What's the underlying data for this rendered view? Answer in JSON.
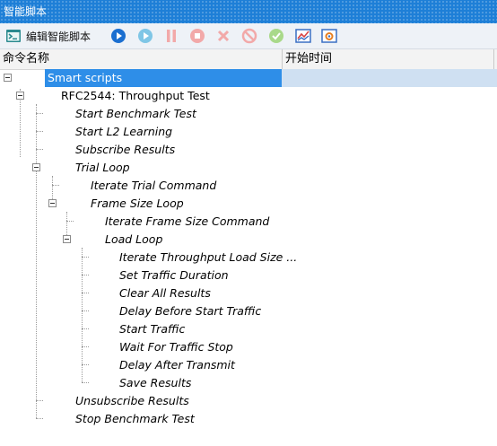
{
  "window": {
    "title": "智能脚本"
  },
  "toolbar": {
    "edit_label": "编辑智能脚本",
    "buttons": [
      {
        "name": "run",
        "icon": "play-icon",
        "color": "#1b6fd0",
        "enabled": true
      },
      {
        "name": "step",
        "icon": "step-icon",
        "color": "#7fc6e6",
        "enabled": false
      },
      {
        "name": "pause",
        "icon": "pause-icon",
        "color": "#f2a9a9",
        "enabled": false
      },
      {
        "name": "stop",
        "icon": "stop-icon",
        "color": "#f2a9a9",
        "enabled": false
      },
      {
        "name": "clear",
        "icon": "close-x-icon",
        "color": "#f2a9a9",
        "enabled": false
      },
      {
        "name": "abort",
        "icon": "no-entry-icon",
        "color": "#f2a9a9",
        "enabled": false
      },
      {
        "name": "check",
        "icon": "check-circle-icon",
        "color": "#a9d98a",
        "enabled": false
      },
      {
        "name": "chart",
        "icon": "chart-icon",
        "color": "#3a6fc4",
        "enabled": true
      },
      {
        "name": "settings",
        "icon": "settings-icon",
        "color": "#3a6fc4",
        "enabled": true
      }
    ]
  },
  "columns": {
    "name": "命令名称",
    "start_time": "开始时间"
  },
  "tree": {
    "root": "Smart scripts",
    "script": "RFC2544: Throughput Test",
    "items": [
      "Start Benchmark Test",
      "Start L2 Learning",
      "Subscribe Results",
      "Trial Loop",
      "Iterate Trial Command",
      "Frame Size Loop",
      "Iterate Frame Size Command",
      "Load Loop",
      "Iterate Throughput Load Size ...",
      "Set Traffic Duration",
      "Clear All Results",
      "Delay Before Start Traffic",
      "Start Traffic",
      "Wait For Traffic Stop",
      "Delay After Transmit",
      "Save Results",
      "Unsubscribe Results",
      "Stop Benchmark Test"
    ]
  },
  "colors": {
    "title_bar": "#1e7fd7",
    "selection": "#2e8ee8"
  }
}
